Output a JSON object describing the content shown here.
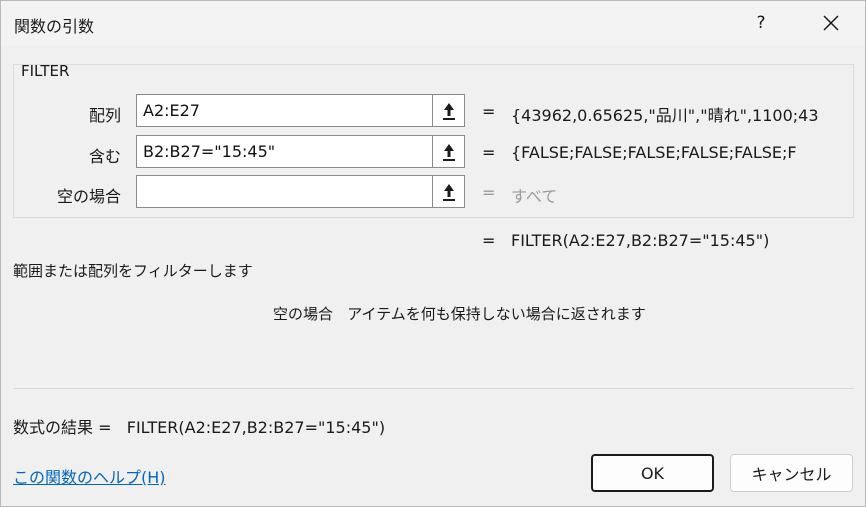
{
  "window": {
    "title": "関数の引数",
    "help_glyph": "?",
    "close_icon": "close-icon"
  },
  "function": {
    "name": "FILTER",
    "args": [
      {
        "label": "配列",
        "value": "A2:E27",
        "result": "{43962,0.65625,\"品川\",\"晴れ\",1100;43",
        "muted": false
      },
      {
        "label": "含む",
        "value": "B2:B27=\"15:45\"",
        "result": "{FALSE;FALSE;FALSE;FALSE;FALSE;F",
        "muted": false
      },
      {
        "label": "空の場合",
        "value": "",
        "result": "すべて",
        "muted": true
      }
    ],
    "eq_sign": "=",
    "formula_result": "FILTER(A2:E27,B2:B27=\"15:45\")",
    "description": "範囲または配列をフィルターします",
    "arg_description": "空の場合   アイテムを何も保持しない場合に返されます"
  },
  "footer": {
    "result_line": "数式の結果 =   FILTER(A2:E27,B2:B27=\"15:45\")",
    "help_link": "この関数のヘルプ(H)",
    "ok_label": "OK",
    "cancel_label": "キャンセル"
  },
  "colors": {
    "link": "#0067c0",
    "muted_text": "#9a9a9a",
    "dialog_bg": "#f0f0f0"
  }
}
